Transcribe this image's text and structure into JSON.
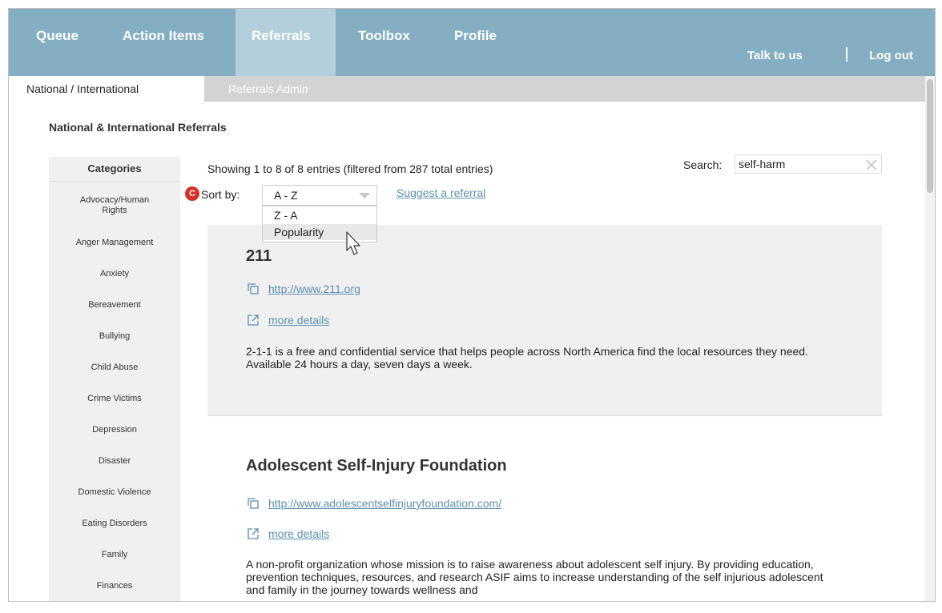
{
  "nav": {
    "items": [
      "Queue",
      "Action Items",
      "Referrals",
      "Toolbox",
      "Profile"
    ],
    "talk": "Talk to us",
    "logout": "Log out",
    "colors": {
      "bar": "#84aec2",
      "active": "#b3cfdc"
    }
  },
  "subnav": {
    "active": "National / International",
    "other": "Referrals Admin"
  },
  "page": {
    "heading": "National & International Referrals"
  },
  "sidebar": {
    "header": "Categories",
    "items": [
      "Advocacy/Human Rights",
      "Anger Management",
      "Anxiety",
      "Bereavement",
      "Bullying",
      "Child Abuse",
      "Crime Victims",
      "Depression",
      "Disaster",
      "Domestic Violence",
      "Eating Disorders",
      "Family",
      "Finances"
    ]
  },
  "list": {
    "showing": "Showing 1 to 8 of 8 entries (filtered from 287 total entries)",
    "search_label": "Search:",
    "search_value": "self-harm",
    "badge": "C",
    "sort_label": "Sort by:",
    "sort_value": "A - Z",
    "sort_options": [
      "Z - A",
      "Popularity"
    ],
    "suggest": "Suggest a referral"
  },
  "entries": [
    {
      "title": "211",
      "url": "http://www.211.org",
      "details": "more details",
      "description": "2-1-1 is a free and confidential service that helps people across North America find the local resources they need. Available 24 hours a day, seven days a week."
    },
    {
      "title": "Adolescent Self-Injury Foundation",
      "url": "http://www.adolescentselfinjuryfoundation.com/",
      "details": "more details",
      "description": "A non-profit organization whose mission is to raise awareness about adolescent self injury. By providing education, prevention techniques, resources, and research ASIF aims to increase understanding of the self injurious adolescent and family in the journey towards wellness and"
    }
  ],
  "icons": [
    "copy-icon",
    "external-link-icon",
    "clear-icon",
    "cursor-icon"
  ]
}
